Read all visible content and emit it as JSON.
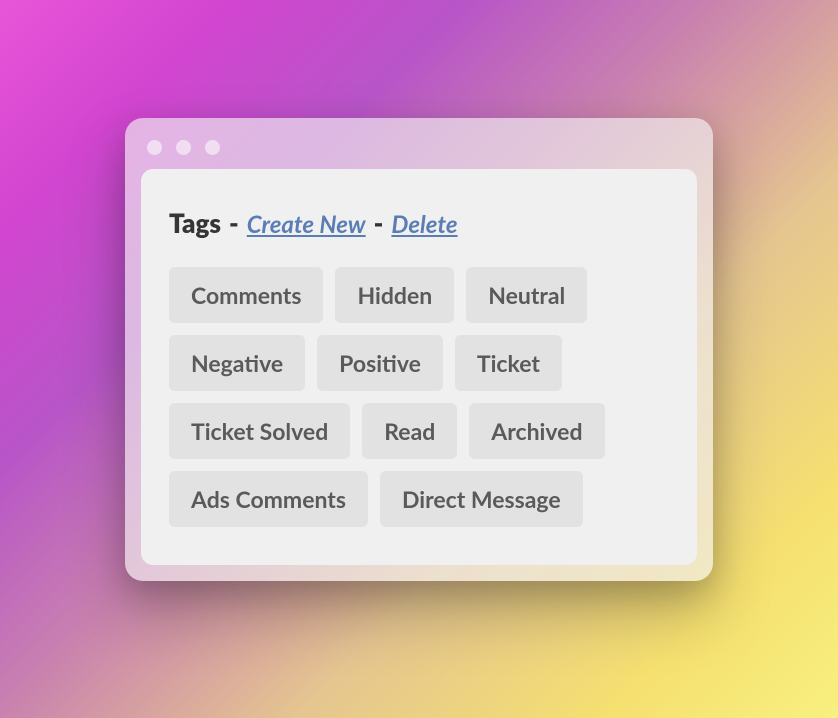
{
  "header": {
    "title": "Tags",
    "separator": "-",
    "createNew": "Create New",
    "delete": "Delete"
  },
  "tags": [
    "Comments",
    "Hidden",
    "Neutral",
    "Negative",
    "Positive",
    "Ticket",
    "Ticket Solved",
    "Read",
    "Archived",
    "Ads Comments",
    "Direct Message"
  ]
}
